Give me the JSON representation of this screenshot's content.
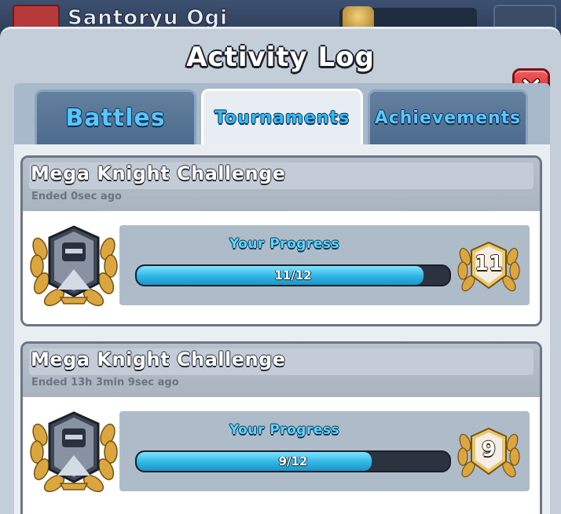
{
  "background": {
    "player_name": "Santoryu Ogi"
  },
  "panel": {
    "title": "Activity Log",
    "close_icon": "close-x-icon"
  },
  "tabs": [
    {
      "label": "Battles",
      "active": false
    },
    {
      "label": "Tournaments",
      "active": true
    },
    {
      "label": "Achievements",
      "active": false
    }
  ],
  "entries": [
    {
      "title": "Mega Knight Challenge",
      "ended": "Ended 0sec ago",
      "progress_label": "Your Progress",
      "progress_text": "11/12",
      "wins": 11,
      "max": 12,
      "wins_display": "11",
      "card_icon": "mega-knight-card-icon"
    },
    {
      "title": "Mega Knight Challenge",
      "ended": "Ended 13h 3min  9sec ago",
      "progress_label": "Your Progress",
      "progress_text": "9/12",
      "wins": 9,
      "max": 12,
      "wins_display": "9",
      "card_icon": "mega-knight-card-icon"
    }
  ],
  "colors": {
    "progress_fill": "#2fb4e6",
    "accent_blue": "#56d8ff",
    "close_red": "#d9333a",
    "laurel_gold": "#d9a640"
  }
}
